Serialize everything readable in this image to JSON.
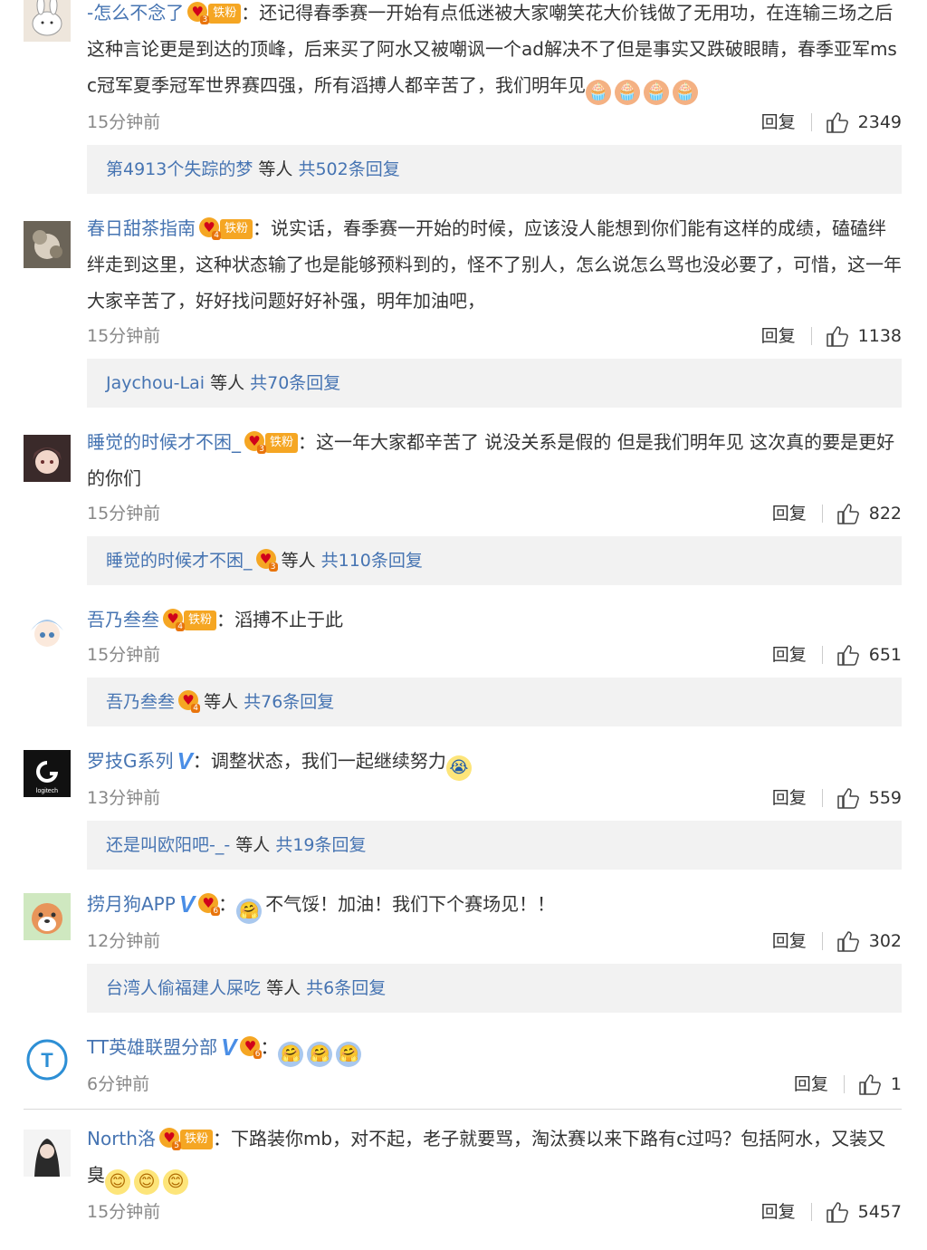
{
  "comments": [
    {
      "username": "-怎么不念了",
      "badge_level": "3",
      "badge_label": "铁粉",
      "text": "：还记得春季赛一开始有点低迷被大家嘲笑花大价钱做了无用功，在连输三场之后这种言论更是到达的顶峰，后来买了阿水又被嘲讽一个ad解决不了但是事实又跌破眼睛，春季亚军msc冠军夏季冠军世界赛四强，所有滔搏人都辛苦了，我们明年见",
      "emojis": [
        "🧁",
        "🧁",
        "🧁",
        "🧁"
      ],
      "time": "15分钟前",
      "reply_label": "回复",
      "likes": "2349",
      "replies_user": "第4913个失踪的梦",
      "replies_mid": "等人",
      "replies_count": "共502条回复"
    },
    {
      "username": "春日甜茶指南",
      "badge_level": "4",
      "badge_label": "铁粉",
      "text": "：说实话，春季赛一开始的时候，应该没人能想到你们能有这样的成绩，磕磕绊绊走到这里，这种状态输了也是能够预料到的，怪不了别人，怎么说怎么骂也没必要了，可惜，这一年大家辛苦了，好好找问题好好补强，明年加油吧，",
      "time": "15分钟前",
      "reply_label": "回复",
      "likes": "1138",
      "replies_user": "Jaychou-Lai",
      "replies_mid": "等人",
      "replies_count": "共70条回复"
    },
    {
      "username": "睡觉的时候才不困_",
      "badge_level": "3",
      "badge_label": "铁粉",
      "text": "：这一年大家都辛苦了 说没关系是假的 但是我们明年见 这次真的要是更好的你们",
      "time": "15分钟前",
      "reply_label": "回复",
      "likes": "822",
      "replies_user": "睡觉的时候才不困_",
      "replies_badge_level": "3",
      "replies_mid": "等人",
      "replies_count": "共110条回复"
    },
    {
      "username": "吾乃叁叁",
      "badge_level": "4",
      "badge_label": "铁粉",
      "text": "：滔搏不止于此",
      "time": "15分钟前",
      "reply_label": "回复",
      "likes": "651",
      "replies_user": "吾乃叁叁",
      "replies_badge_level": "4",
      "replies_mid": "等人",
      "replies_count": "共76条回复"
    },
    {
      "username": "罗技G系列",
      "verified": "V",
      "text": "：调整状态，我们一起继续努力",
      "time": "13分钟前",
      "reply_label": "回复",
      "likes": "559",
      "replies_user": "还是叫欧阳吧-_-",
      "replies_mid": "等人",
      "replies_count": "共19条回复"
    },
    {
      "username": "捞月狗APP",
      "verified": "V",
      "badge_level": "6",
      "text": "不气馁！加油！我们下个赛场见！！",
      "time": "12分钟前",
      "reply_label": "回复",
      "likes": "302",
      "replies_user": "台湾人偷福建人屎吃",
      "replies_mid": "等人",
      "replies_count": "共6条回复"
    },
    {
      "username": "TT英雄联盟分部",
      "verified": "V",
      "badge_level": "6",
      "text": "：",
      "time": "6分钟前",
      "reply_label": "回复",
      "likes": "1"
    },
    {
      "username": "North洛",
      "badge_level": "5",
      "badge_label": "铁粉",
      "text": "：下路装你mb，对不起，老子就要骂，淘汰赛以来下路有c过吗？包括阿水，又装又臭",
      "time": "15分钟前",
      "reply_label": "回复",
      "likes": "5457"
    }
  ],
  "icons": {
    "like": "thumbs-up-outline-icon",
    "heart_badge": "heart-fan-badge-icon",
    "verified": "verified-v-icon"
  },
  "colors": {
    "username": "#4674b2",
    "badge": "#f5a623",
    "verified": "#4a8ee6",
    "reply_box": "#f2f2f2",
    "meta": "#888888"
  },
  "avatars": {
    "logitech_text": "logitech",
    "tt_text": "T"
  }
}
